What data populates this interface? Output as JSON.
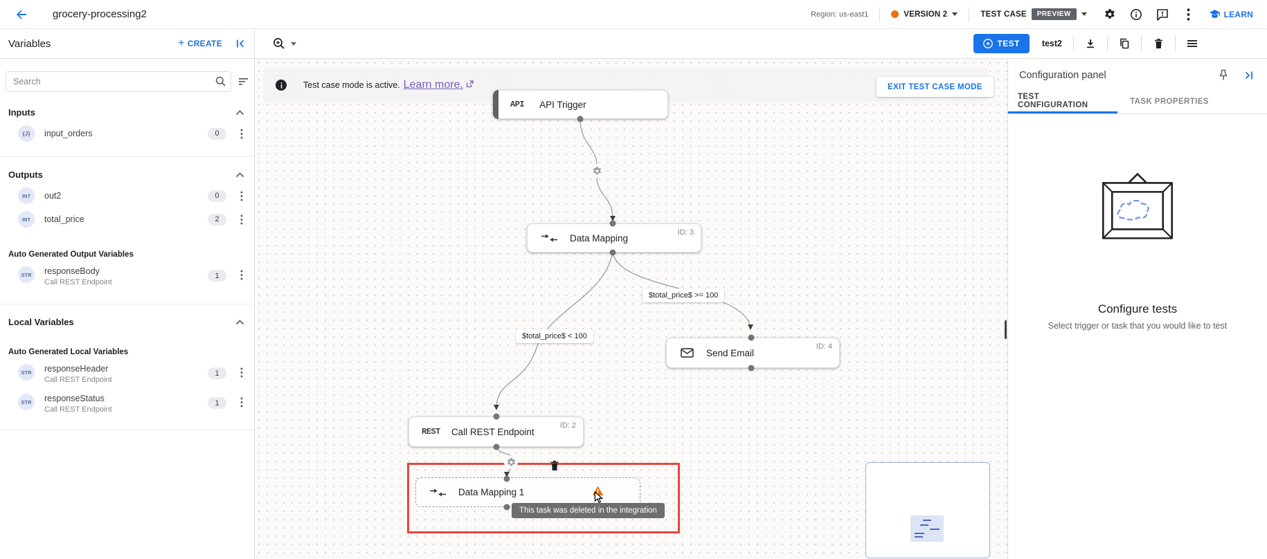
{
  "header": {
    "title": "grocery-processing2",
    "region": "Region: us-east1",
    "version": "VERSION 2",
    "test_case": "TEST CASE",
    "preview": "PREVIEW",
    "learn": "LEARN"
  },
  "actions": {
    "variables_title": "Variables",
    "create": "CREATE",
    "create_plus": "+",
    "test": "TEST",
    "test_case_name": "test2"
  },
  "sidebar": {
    "search_placeholder": "Search",
    "inputs": {
      "title": "Inputs",
      "items": [
        {
          "type": "{J}",
          "name": "input_orders",
          "count": "0"
        }
      ]
    },
    "outputs": {
      "title": "Outputs",
      "items": [
        {
          "type": "INT",
          "name": "out2",
          "count": "0"
        },
        {
          "type": "INT",
          "name": "total_price",
          "count": "2"
        }
      ],
      "auto_title": "Auto Generated Output Variables",
      "auto_items": [
        {
          "type": "STR",
          "name": "responseBody",
          "source": "Call REST Endpoint",
          "count": "1"
        }
      ]
    },
    "locals": {
      "title": "Local Variables",
      "auto_title": "Auto Generated Local Variables",
      "auto_items": [
        {
          "type": "STR",
          "name": "responseHeader",
          "source": "Call REST Endpoint",
          "count": "1"
        },
        {
          "type": "STR",
          "name": "responseStatus",
          "source": "Call REST Endpoint",
          "count": "1"
        }
      ]
    }
  },
  "canvas": {
    "banner": {
      "text": "Test case mode is active.",
      "link": "Learn more.",
      "exit": "EXIT TEST CASE MODE"
    },
    "nodes": {
      "api_trigger": {
        "glyph": "API",
        "label": "API Trigger"
      },
      "data_mapping": {
        "label": "Data Mapping",
        "id": "ID: 3"
      },
      "send_email": {
        "label": "Send Email",
        "id": "ID: 4"
      },
      "call_rest": {
        "glyph": "REST",
        "label": "Call REST Endpoint",
        "id": "ID: 2"
      },
      "data_mapping_1": {
        "label": "Data Mapping 1"
      }
    },
    "edge_labels": {
      "high": "$total_price$ >= 100",
      "low": "$total_price$ < 100"
    },
    "tooltip": "This task was deleted in the integration"
  },
  "config_panel": {
    "title": "Configuration panel",
    "tabs": [
      {
        "label": "TEST CONFIGURATION"
      },
      {
        "label": "TASK PROPERTIES"
      }
    ],
    "empty_title": "Configure tests",
    "empty_subtitle": "Select trigger or task that you would like to test"
  },
  "colors": {
    "accent": "#1a73e8",
    "version_dot": "#e8710a",
    "preview_badge_bg": "#5f6368",
    "selection_red": "#e8453c",
    "warning_orange": "#e8710a",
    "link_purple": "#7c5cbf"
  }
}
